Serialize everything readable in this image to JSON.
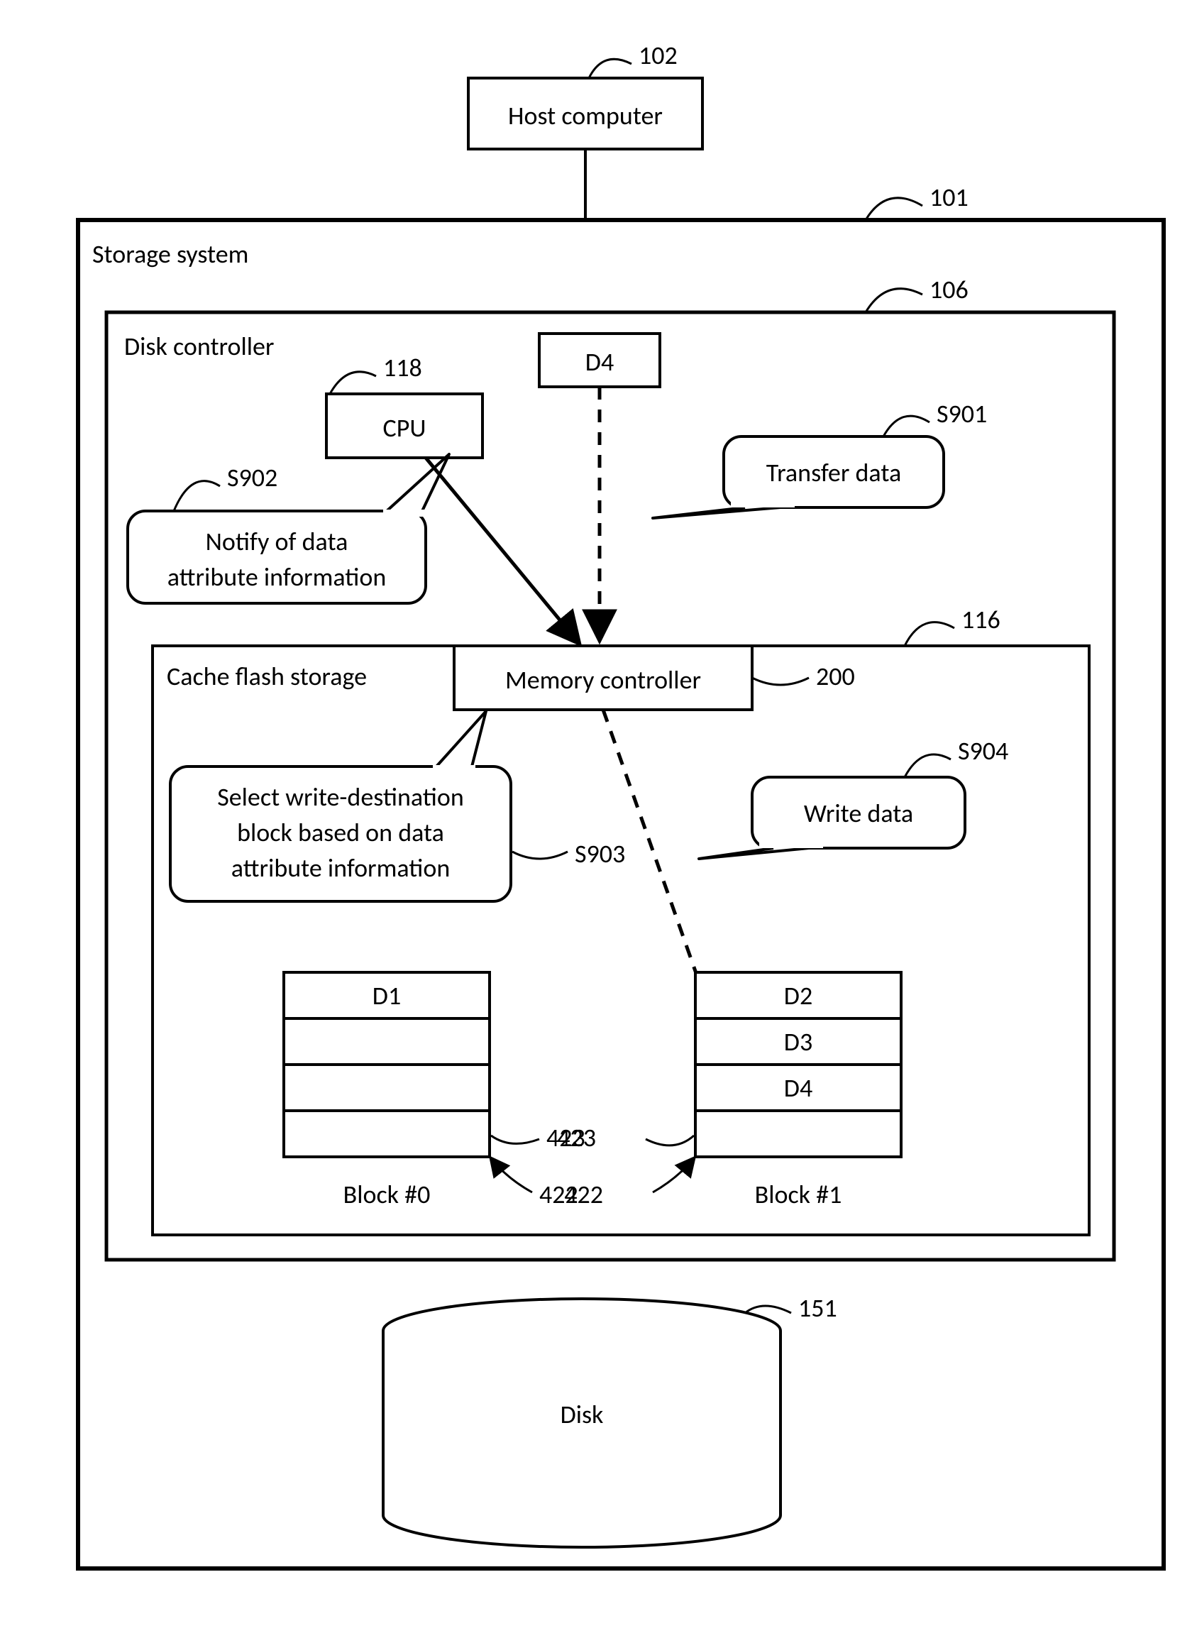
{
  "boxes": {
    "host_computer": "Host computer",
    "storage_system": "Storage system",
    "disk_controller": "Disk controller",
    "cpu": "CPU",
    "d4_buffer": "D4",
    "memory_controller": "Memory controller",
    "cache_flash_storage": "Cache flash storage",
    "disk": "Disk"
  },
  "callouts": {
    "s901": "Transfer data",
    "s902_line1": "Notify of data",
    "s902_line2": "attribute information",
    "s903_line1": "Select write-destination",
    "s903_line2": "block based on data",
    "s903_line3": "attribute information",
    "s904": "Write data"
  },
  "blocks": {
    "block0": {
      "label": "Block #0",
      "cells": [
        "D1",
        "",
        "",
        ""
      ]
    },
    "block1": {
      "label": "Block #1",
      "cells": [
        "D2",
        "D3",
        "D4",
        ""
      ]
    }
  },
  "refs": {
    "host": "102",
    "storage": "101",
    "disk_controller": "106",
    "cpu": "118",
    "cfs": "116",
    "mc": "200",
    "disk": "151",
    "s901": "S901",
    "s902": "S902",
    "s903": "S903",
    "s904": "S904",
    "page0": "423",
    "page1": "423",
    "block0": "422",
    "block1": "422"
  }
}
